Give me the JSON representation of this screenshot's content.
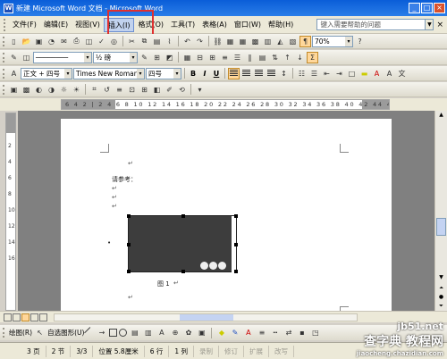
{
  "window": {
    "title": "新建 Microsoft Word 文档 - Microsoft Word",
    "app_icon": "W",
    "controls": [
      "_",
      "□",
      "×"
    ]
  },
  "menubar": {
    "items": [
      {
        "label": "文件(F)"
      },
      {
        "label": "编辑(E)"
      },
      {
        "label": "视图(V)"
      },
      {
        "label": "插入(I)",
        "highlighted": true
      },
      {
        "label": "格式(O)"
      },
      {
        "label": "工具(T)"
      },
      {
        "label": "表格(A)"
      },
      {
        "label": "窗口(W)"
      },
      {
        "label": "帮助(H)"
      }
    ],
    "help_placeholder": "键入需要帮助的问题",
    "close_glyph": "×"
  },
  "standard_toolbar": {
    "zoom": "70%"
  },
  "drawing_toolbar_top": {
    "line_weight": "½ 磅"
  },
  "formatting_toolbar": {
    "style": "正文 + 四号",
    "font": "Times New Roman",
    "size": "四号",
    "bold": "B",
    "italic": "I",
    "underline": "U"
  },
  "ruler": {
    "numbers": "6 4 2 | 2 4 6 8 10 12 14 16 18 20 22 24 26 28 30 32 34 36 38 40 42 44 46 48",
    "vertical_numbers": [
      "2",
      "4",
      "6",
      "8",
      "10",
      "12",
      "14",
      "16"
    ]
  },
  "document": {
    "text_ref": "请参考：",
    "caption": "图 1",
    "paragraph_mark": "↵"
  },
  "drawing_toolbar": {
    "draw_label": "绘图(R)",
    "autoshapes_label": "自选图形(U)"
  },
  "statusbar": {
    "page": "3 页",
    "section": "2 节",
    "pages": "3/3",
    "position": "位置 5.8厘米",
    "line": "6 行",
    "column": "1 列",
    "rec": "录制",
    "trk": "修订",
    "ext": "扩展",
    "ovr": "改写"
  },
  "watermark": {
    "line1": "jb51.net",
    "line2": "查字典 教程网",
    "line3": "jiaocheng.chazidian.com"
  },
  "colors": {
    "title_bar": "#0a5dd8",
    "highlight_box": "#e03030",
    "workspace": "#808080"
  }
}
